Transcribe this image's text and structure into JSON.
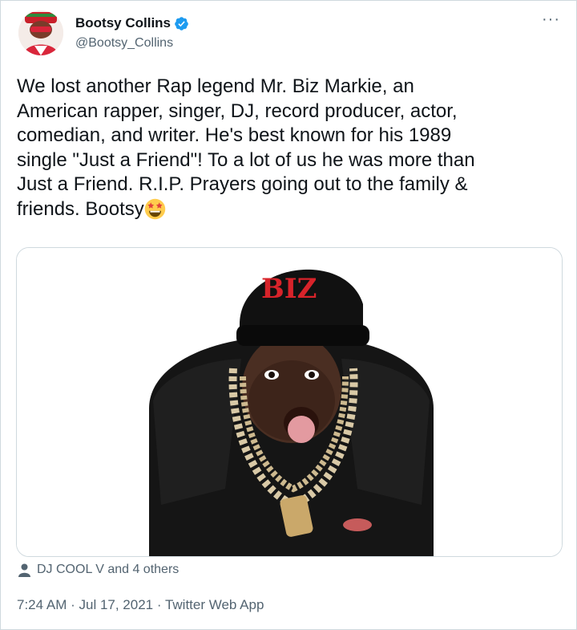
{
  "author": {
    "name": "Bootsy Collins",
    "handle": "@Bootsy_Collins",
    "verified_icon": "verified-badge-icon",
    "more_icon": "more-options-icon",
    "more_label": "···"
  },
  "tweet": {
    "text": "We lost another Rap legend Mr. Biz Markie, an\nAmerican rapper, singer, DJ, record producer, actor,\ncomedian, and writer. He's best known for his 1989\nsingle \"Just a Friend\"! To a lot of us he was more than\nJust a Friend. R.I.P. Prayers going out to the family &\nfriends. Bootsy",
    "emoji": "star-struck-emoji",
    "image": {
      "cap_text": "BIZ"
    }
  },
  "tagged": {
    "icon": "person-icon",
    "label": "DJ COOL V and 4 others"
  },
  "meta": {
    "time": "7:24 AM",
    "sep1": " · ",
    "date": "Jul 17, 2021",
    "sep2": " · ",
    "source": "Twitter Web App"
  },
  "colors": {
    "primary_text": "#0f1419",
    "secondary_text": "#536471",
    "border": "#cfd9de",
    "verified_blue": "#1d9bf0"
  }
}
